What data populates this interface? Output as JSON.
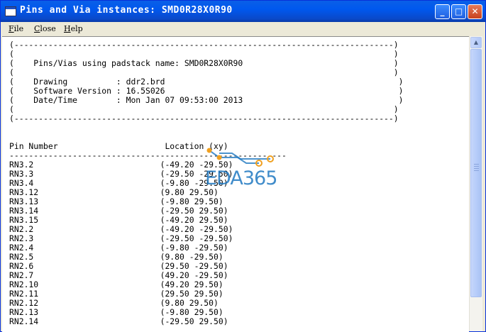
{
  "window": {
    "title": "Pins and Via instances: SMD0R28X0R90",
    "buttons": {
      "minimize": "_",
      "maximize": "□",
      "close": "✕"
    }
  },
  "menu": [
    {
      "accel": "F",
      "rest": "ile"
    },
    {
      "accel": "C",
      "rest": "lose"
    },
    {
      "accel": "H",
      "rest": "elp"
    }
  ],
  "report": {
    "border_top": "(------------------------------------------------------------------------------)",
    "blank_line": "(                                                                              )",
    "padstack_line": "(    Pins/Vias using padstack name: SMD0R28X0R90                               )",
    "drawing_line": "(    Drawing          : ddr2.brd                                                )",
    "software_line": "(    Software Version : 16.5S026                                                )",
    "datetime_line": "(    Date/Time        : Mon Jan 07 09:53:00 2013                                )",
    "border_bottom": "(------------------------------------------------------------------------------)",
    "header_line": "Pin Number                      Location (xy)",
    "underline": "---------------------------------------------------------",
    "rows": [
      "RN3.2                          (-49.20 -29.50)",
      "RN3.3                          (-29.50 -29.50)",
      "RN3.4                          (-9.80 -29.50)",
      "RN3.12                         (9.80 29.50)",
      "RN3.13                         (-9.80 29.50)",
      "RN3.14                         (-29.50 29.50)",
      "RN3.15                         (-49.20 29.50)",
      "RN2.2                          (-49.20 -29.50)",
      "RN2.3                          (-29.50 -29.50)",
      "RN2.4                          (-9.80 -29.50)",
      "RN2.5                          (9.80 -29.50)",
      "RN2.6                          (29.50 -29.50)",
      "RN2.7                          (49.20 -29.50)",
      "RN2.10                         (49.20 29.50)",
      "RN2.11                         (29.50 29.50)",
      "RN2.12                         (9.80 29.50)",
      "RN2.13                         (-9.80 29.50)",
      "RN2.14                         (-29.50 29.50)"
    ]
  },
  "watermark": {
    "text": "EDA365",
    "color": "#1f78c1",
    "accent": "#f0a020"
  },
  "scroll": {
    "up_arrow": "▲"
  }
}
